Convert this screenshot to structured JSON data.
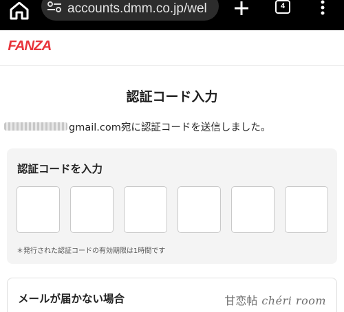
{
  "browser": {
    "url": "accounts.dmm.co.jp/wel",
    "tab_count": "4"
  },
  "header": {
    "logo": "FANZA"
  },
  "page": {
    "title": "認証コード入力",
    "sent_message_suffix": "gmail.com宛に認証コードを送信しました。"
  },
  "code_section": {
    "label": "認証コードを入力",
    "digit_count": 6,
    "note": "＊発行された認証コードの有効期限は1時間です"
  },
  "mail_section": {
    "title": "メールが届かない場合"
  },
  "watermark": {
    "jp": "甘恋帖",
    "latin": "chéri room"
  },
  "colors": {
    "brand": "#e8343b",
    "panel_bg": "#f4f4f4",
    "chrome_bg": "#000000"
  }
}
